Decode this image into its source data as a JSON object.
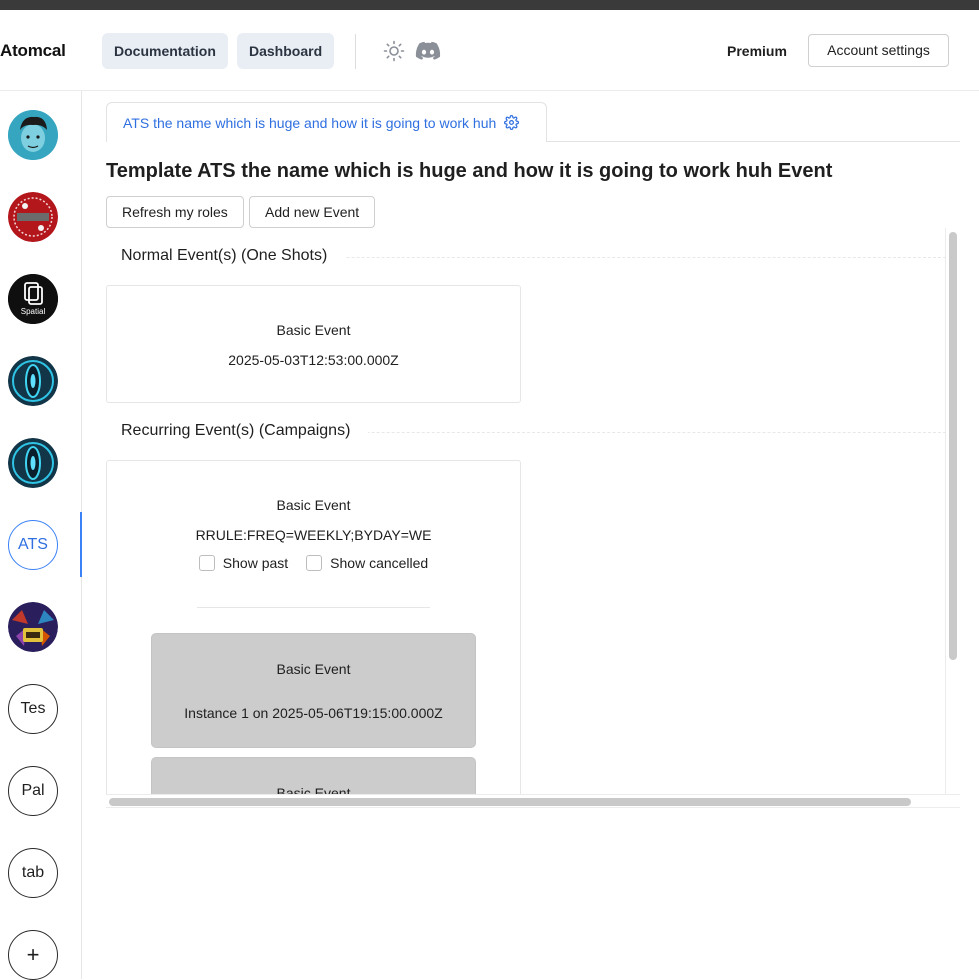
{
  "header": {
    "brand": "Atomcal",
    "nav": {
      "documentation": "Documentation",
      "dashboard": "Dashboard"
    },
    "premium": "Premium",
    "account_settings": "Account settings"
  },
  "sidebar": {
    "servers": [
      {
        "kind": "avatar",
        "name": "avatar-cartoon"
      },
      {
        "kind": "avatar",
        "name": "avatar-red-logo"
      },
      {
        "kind": "avatar",
        "name": "avatar-spatial",
        "label": "Spatial"
      },
      {
        "kind": "avatar",
        "name": "avatar-eye-1"
      },
      {
        "kind": "avatar",
        "name": "avatar-eye-2"
      },
      {
        "kind": "text",
        "label": "ATS",
        "active": true
      },
      {
        "kind": "avatar",
        "name": "avatar-colorful"
      },
      {
        "kind": "text",
        "label": "Tes"
      },
      {
        "kind": "text",
        "label": "Pal"
      },
      {
        "kind": "text",
        "label": "tab"
      },
      {
        "kind": "text",
        "label": "+"
      }
    ]
  },
  "tab": {
    "label": "ATS the name which is huge and how it is going to work huh",
    "icon": "gear-icon"
  },
  "main": {
    "title": "Template ATS the name which is huge and how it is going to work huh Event",
    "buttons": {
      "refresh": "Refresh my roles",
      "add": "Add new Event"
    },
    "normal": {
      "title": "Normal Event(s) (One Shots)",
      "event": {
        "name": "Basic Event",
        "date": "2025-05-03T12:53:00.000Z"
      }
    },
    "recurring": {
      "title": "Recurring Event(s) (Campaigns)",
      "event": {
        "name": "Basic Event",
        "rule": "RRULE:FREQ=WEEKLY;BYDAY=WE"
      },
      "show_past": "Show past",
      "show_cancelled": "Show cancelled",
      "instances": [
        {
          "name": "Basic Event",
          "text": "Instance 1 on 2025-05-06T19:15:00.000Z"
        },
        {
          "name": "Basic Event",
          "text": ""
        }
      ]
    }
  },
  "colors": {
    "accent": "#3b82f6",
    "nav_bg": "#e9eef5",
    "instance_bg": "#cccccc"
  }
}
